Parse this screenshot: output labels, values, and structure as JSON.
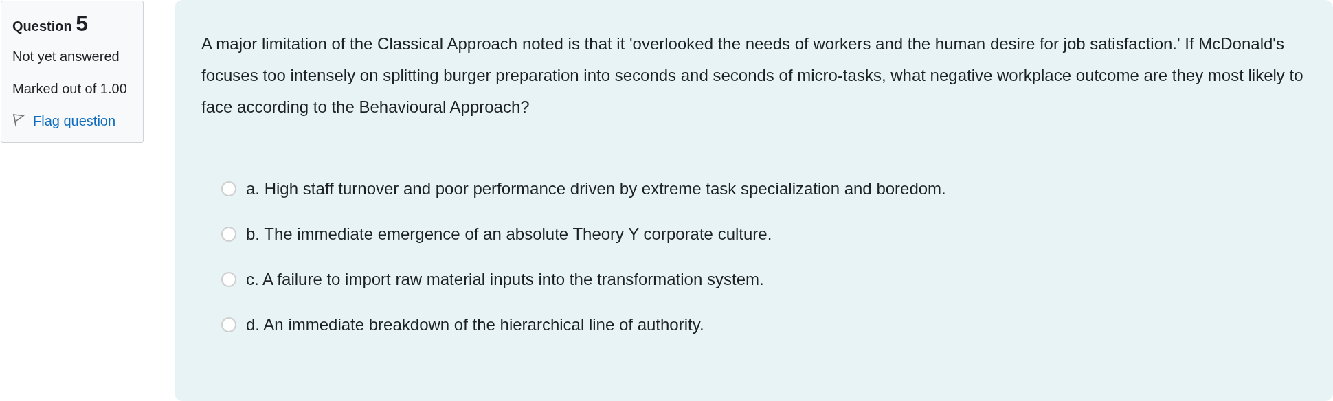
{
  "info": {
    "label": "Question",
    "number": "5",
    "status": "Not yet answered",
    "marks": "Marked out of 1.00",
    "flag": {
      "label": "Flag question",
      "flagged": false
    }
  },
  "question": {
    "text": "A major limitation of the Classical Approach noted is that it 'overlooked the needs of workers and the human desire for job satisfaction.' If McDonald's focuses too intensely on splitting burger preparation into seconds and seconds of micro-tasks, what negative workplace outcome are they most likely to face according to the Behavioural Approach?",
    "options": [
      {
        "text": "a. High staff turnover and poor performance driven by extreme task specialization and boredom.",
        "selected": false
      },
      {
        "text": "b. The immediate emergence of an absolute Theory Y corporate culture.",
        "selected": false
      },
      {
        "text": "c. A failure to import raw material inputs into the transformation system.",
        "selected": false
      },
      {
        "text": "d. An immediate breakdown of the hierarchical line of authority.",
        "selected": false
      }
    ]
  }
}
